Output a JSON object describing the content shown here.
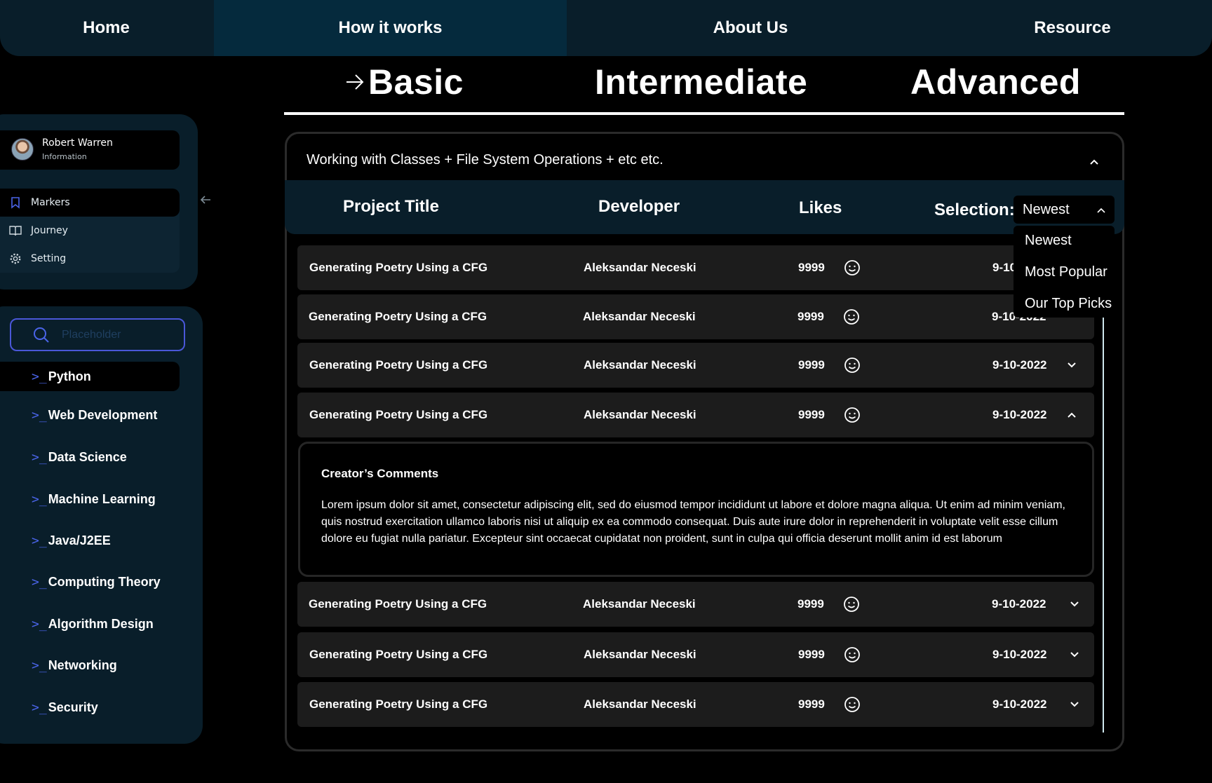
{
  "topnav": {
    "items": [
      {
        "label": "Home"
      },
      {
        "label": "How it works"
      },
      {
        "label": "About Us"
      },
      {
        "label": "Resource"
      }
    ],
    "active": "How it works",
    "active_color": "#052a3d"
  },
  "levels": {
    "tabs": [
      {
        "label": "Basic"
      },
      {
        "label": "Intermediate"
      },
      {
        "label": "Advanced"
      }
    ],
    "active": "Basic"
  },
  "profile": {
    "name": "Robert Warren",
    "subtitle": "Information"
  },
  "menu": {
    "items": [
      {
        "label": "Markers",
        "icon": "bookmark-icon"
      },
      {
        "label": "Journey",
        "icon": "book-open-icon"
      },
      {
        "label": "Setting",
        "icon": "gear-icon"
      }
    ],
    "active": "Markers"
  },
  "search": {
    "placeholder": "Placeholder",
    "value": ""
  },
  "categories": {
    "items": [
      {
        "label": "Python"
      },
      {
        "label": "Web Development"
      },
      {
        "label": "Data Science"
      },
      {
        "label": "Machine Learning"
      },
      {
        "label": "Java/J2EE"
      },
      {
        "label": "Computing Theory"
      },
      {
        "label": "Algorithm Design"
      },
      {
        "label": "Networking"
      },
      {
        "label": "Security"
      }
    ],
    "active": "Python",
    "prompt_symbol": ">_"
  },
  "section": {
    "title": "Working with Classes + File System Operations + etc etc."
  },
  "table": {
    "headers": {
      "project": "Project Title",
      "developer": "Developer",
      "likes": "Likes",
      "selection": "Selection:"
    },
    "sort": {
      "selected": "Newest",
      "options": [
        {
          "label": "Newest"
        },
        {
          "label": "Most Popular"
        },
        {
          "label": "Our Top Picks"
        }
      ],
      "open": true
    },
    "rows": [
      {
        "title": "Generating Poetry Using a CFG",
        "developer": "Aleksandar Neceski",
        "likes": "9999",
        "date": "9-10-2022",
        "expanded": false
      },
      {
        "title": "Generating Poetry Using a CFG",
        "developer": "Aleksandar Neceski",
        "likes": "9999",
        "date": "9-10-2022",
        "expanded": false
      },
      {
        "title": "Generating Poetry Using a CFG",
        "developer": "Aleksandar Neceski",
        "likes": "9999",
        "date": "9-10-2022",
        "expanded": false
      },
      {
        "title": "Generating Poetry Using a CFG",
        "developer": "Aleksandar Neceski",
        "likes": "9999",
        "date": "9-10-2022",
        "expanded": true
      },
      {
        "title": "Generating Poetry Using a CFG",
        "developer": "Aleksandar Neceski",
        "likes": "9999",
        "date": "9-10-2022",
        "expanded": false
      },
      {
        "title": "Generating Poetry Using a CFG",
        "developer": "Aleksandar Neceski",
        "likes": "9999",
        "date": "9-10-2022",
        "expanded": false
      },
      {
        "title": "Generating Poetry Using a CFG",
        "developer": "Aleksandar Neceski",
        "likes": "9999",
        "date": "9-10-2022",
        "expanded": false
      }
    ],
    "comments": {
      "title": "Creator’s Comments",
      "body": "Lorem ipsum dolor sit amet, consectetur adipiscing elit, sed do eiusmod tempor incididunt ut labore et dolore magna aliqua. Ut enim ad minim veniam, quis nostrud exercitation ullamco laboris nisi ut aliquip ex ea commodo consequat. Duis aute irure dolor in reprehenderit in voluptate velit esse cillum dolore eu fugiat nulla pariatur. Excepteur sint occaecat cupidatat non proident, sunt in culpa qui officia deserunt mollit anim id est laborum"
    }
  },
  "colors": {
    "background": "#000000",
    "panel": "#091e2a",
    "accent": "#4a64e8",
    "row": "#1c1c1c"
  }
}
